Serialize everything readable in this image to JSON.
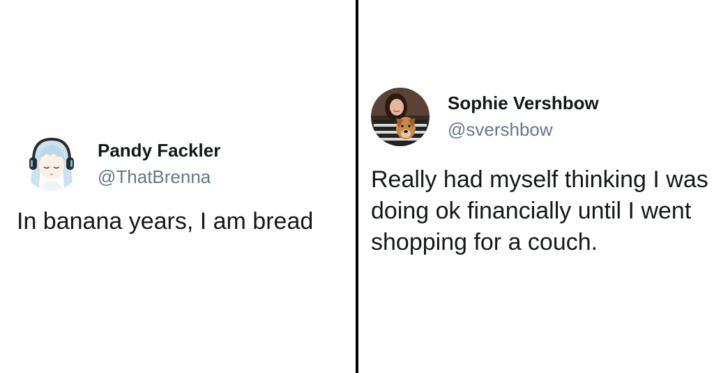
{
  "left_tweet": {
    "display_name": "Pandy Fackler",
    "handle": "@ThatBrenna",
    "text": "In banana years, I am bread",
    "avatar_icon": "anime-girl-headphones-avatar"
  },
  "right_tweet": {
    "display_name": "Sophie Vershbow",
    "handle": "@svershbow",
    "text": "Really had myself thinking I was doing ok financially until I went shopping for a couch.",
    "avatar_icon": "woman-with-dog-avatar"
  },
  "colors": {
    "name": "#14171a",
    "handle": "#657786",
    "divider": "#000000",
    "background": "#ffffff"
  }
}
